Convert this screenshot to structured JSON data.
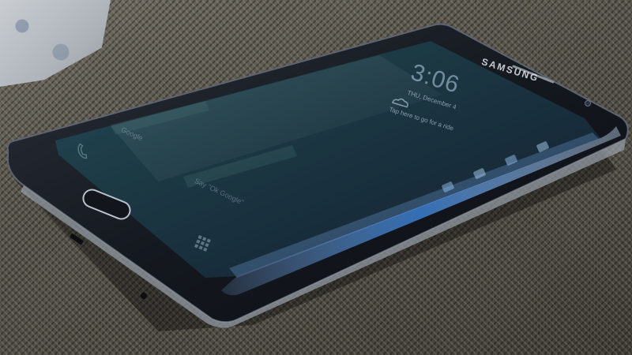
{
  "phone": {
    "brand": "SAMSUNG",
    "lock_screen": {
      "time": "3:06",
      "date": "THU, December 4",
      "hint": "Tap here to go for a ride",
      "app_label_1": "Google",
      "app_label_2": "Say \"Ok Google\""
    }
  },
  "colors": {
    "placemat": "#55524a",
    "phone_body": "#141821",
    "screen": "#1a3340",
    "edge_glare": "#3a7ed0"
  },
  "icons": [
    "weather-icon",
    "phone-icon",
    "app-grid-icon",
    "home-button",
    "front-camera"
  ]
}
